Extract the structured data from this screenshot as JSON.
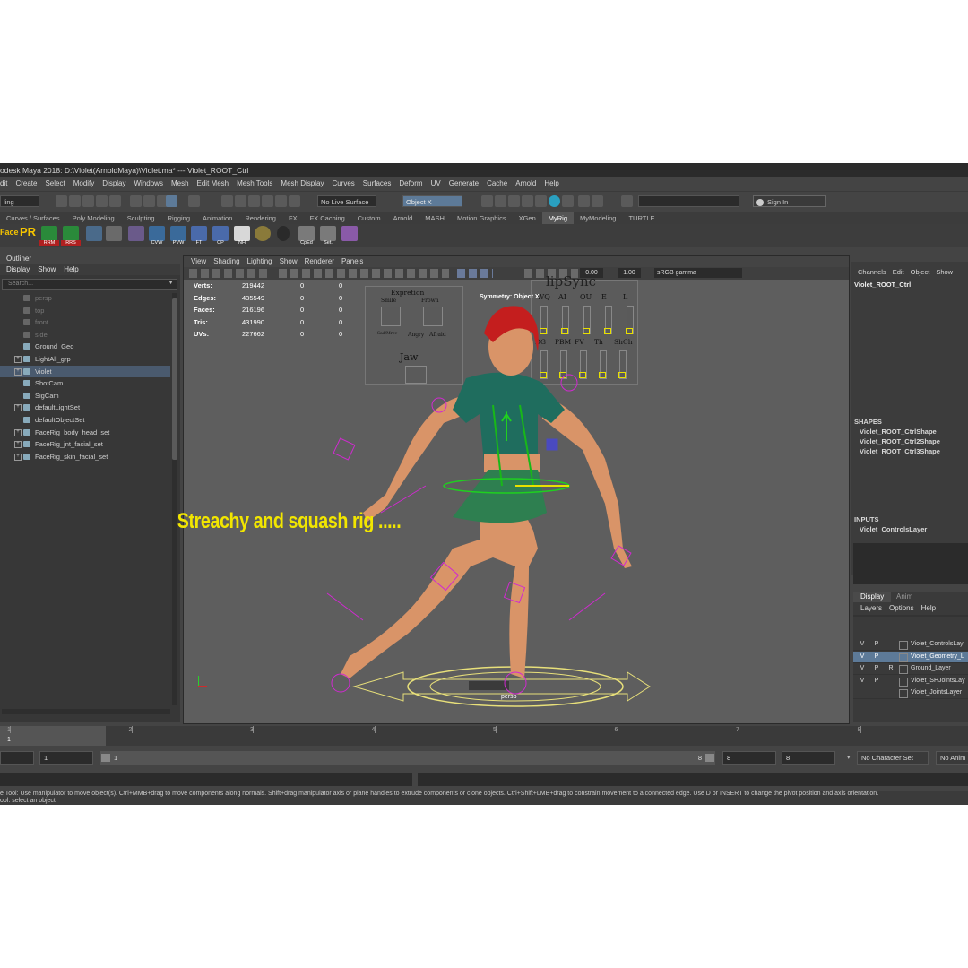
{
  "title_bar": {
    "text": "odesk Maya 2018: D:\\Violet(ArnoldMaya)\\Violet.ma*   ---   Violet_ROOT_Ctrl"
  },
  "menu": [
    "dit",
    "Create",
    "Select",
    "Modify",
    "Display",
    "Windows",
    "Mesh",
    "Edit Mesh",
    "Mesh Tools",
    "Mesh Display",
    "Curves",
    "Surfaces",
    "Deform",
    "UV",
    "Generate",
    "Cache",
    "Arnold",
    "Help"
  ],
  "status_line": {
    "mode_dropdown": "ling",
    "live_surface": "No Live Surface",
    "object_field": "Object X",
    "sign_in": "Sign In"
  },
  "shelf_tabs": [
    {
      "label": "Curves / Surfaces",
      "active": false
    },
    {
      "label": "Poly Modeling",
      "active": false
    },
    {
      "label": "Sculpting",
      "active": false
    },
    {
      "label": "Rigging",
      "active": false
    },
    {
      "label": "Animation",
      "active": false
    },
    {
      "label": "Rendering",
      "active": false
    },
    {
      "label": "FX",
      "active": false
    },
    {
      "label": "FX Caching",
      "active": false
    },
    {
      "label": "Custom",
      "active": false
    },
    {
      "label": "Arnold",
      "active": false
    },
    {
      "label": "MASH",
      "active": false
    },
    {
      "label": "Motion Graphics",
      "active": false
    },
    {
      "label": "XGen",
      "active": false
    },
    {
      "label": "MyRig",
      "active": true
    },
    {
      "label": "MyModeling",
      "active": false
    },
    {
      "label": "TURTLE",
      "active": false
    }
  ],
  "shelf": {
    "face_label": "Face",
    "pr_label": "PR",
    "icons": [
      "RRM",
      "RRS",
      "CVW",
      "PVW",
      "FT",
      "CP",
      "NH",
      "CpEd",
      "Set."
    ]
  },
  "outliner": {
    "title": "Outliner",
    "menu": [
      "Display",
      "Show",
      "Help"
    ],
    "search_placeholder": "Search...",
    "items": [
      {
        "label": "persp",
        "dim": true,
        "expand": false,
        "selected": false
      },
      {
        "label": "top",
        "dim": true,
        "expand": false,
        "selected": false
      },
      {
        "label": "front",
        "dim": true,
        "expand": false,
        "selected": false
      },
      {
        "label": "side",
        "dim": true,
        "expand": false,
        "selected": false
      },
      {
        "label": "Ground_Geo",
        "dim": false,
        "expand": false,
        "selected": false
      },
      {
        "label": "LightAll_grp",
        "dim": false,
        "expand": true,
        "selected": false
      },
      {
        "label": "Violet",
        "dim": false,
        "expand": true,
        "selected": true
      },
      {
        "label": "ShotCam",
        "dim": false,
        "expand": false,
        "selected": false
      },
      {
        "label": "SigCam",
        "dim": false,
        "expand": false,
        "selected": false
      },
      {
        "label": "defaultLightSet",
        "dim": false,
        "expand": true,
        "selected": false
      },
      {
        "label": "defaultObjectSet",
        "dim": false,
        "expand": false,
        "selected": false
      },
      {
        "label": "FaceRig_body_head_set",
        "dim": false,
        "expand": true,
        "selected": false
      },
      {
        "label": "FaceRig_jnt_facial_set",
        "dim": false,
        "expand": true,
        "selected": false
      },
      {
        "label": "FaceRig_skin_facial_set",
        "dim": false,
        "expand": true,
        "selected": false
      }
    ]
  },
  "viewport": {
    "menu": [
      "View",
      "Shading",
      "Lighting",
      "Show",
      "Renderer",
      "Panels"
    ],
    "exposure": "0.00",
    "gamma": "1.00",
    "color_space": "sRGB gamma",
    "camera_label": "persp",
    "symmetry": "Symmetry: Object X",
    "overlay_text": "Streachy and squash rig .....",
    "overlay_color": "#f2e600",
    "stats": [
      {
        "label": "Verts:",
        "value": "219442",
        "a": "0",
        "b": "0"
      },
      {
        "label": "Edges:",
        "value": "435549",
        "a": "0",
        "b": "0"
      },
      {
        "label": "Faces:",
        "value": "216196",
        "a": "0",
        "b": "0"
      },
      {
        "label": "Tris:",
        "value": "431990",
        "a": "0",
        "b": "0"
      },
      {
        "label": "UVs:",
        "value": "227662",
        "a": "0",
        "b": "0"
      }
    ],
    "face_ui": {
      "expression_title": "Expretion",
      "expressions": [
        "Smile",
        "Frown",
        "Sad/Mrev",
        "Angry",
        "Afraid"
      ],
      "jaw_label": "Jaw",
      "lipsync_title": "lipSync",
      "phonemes_top": [
        "WQ",
        "AI",
        "OU",
        "E",
        "L"
      ],
      "phonemes_bottom": [
        "DG",
        "PBM",
        "FV",
        "Th",
        "ShCh"
      ]
    }
  },
  "channel_box": {
    "menu": [
      "Channels",
      "Edit",
      "Object",
      "Show"
    ],
    "object_name": "Violet_ROOT_Ctrl",
    "shapes_heading": "SHAPES",
    "shapes": [
      "Violet_ROOT_CtrlShape",
      "Violet_ROOT_Ctrl2Shape",
      "Violet_ROOT_Ctrl3Shape"
    ],
    "inputs_heading": "INPUTS",
    "inputs": [
      "Violet_ControlsLayer"
    ]
  },
  "layer_editor": {
    "tabs": [
      "Display",
      "Anim"
    ],
    "menu": [
      "Layers",
      "Options",
      "Help"
    ],
    "layers": [
      {
        "v": "V",
        "p": "P",
        "r": "",
        "name": "Violet_ControlsLay",
        "selected": false
      },
      {
        "v": "V",
        "p": "P",
        "r": "",
        "name": "Violet_Geometry_L",
        "selected": true
      },
      {
        "v": "V",
        "p": "P",
        "r": "R",
        "name": "Ground_Layer",
        "selected": false
      },
      {
        "v": "V",
        "p": "P",
        "r": "",
        "name": "Violet_SHJointsLay",
        "selected": false
      },
      {
        "v": "",
        "p": "",
        "r": "",
        "name": "Violet_JointsLayer",
        "selected": false
      }
    ]
  },
  "timeline": {
    "ticks": [
      "1",
      "2",
      "3",
      "4",
      "5",
      "6",
      "7",
      "8"
    ],
    "current": "1"
  },
  "range": {
    "start": "1",
    "range_start": "1",
    "range_end": "8",
    "end1": "8",
    "end2": "8",
    "character_set": "No Character Set",
    "anim_layer": "No Anim"
  },
  "help_line": {
    "line1": "e Tool: Use manipulator to move object(s). Ctrl+MMB+drag to move components along normals. Shift+drag manipulator axis or plane handles to extrude components or clone objects. Ctrl+Shift+LMB+drag to constrain movement to a connected edge. Use D or INSERT to change the pivot position and axis orientation.",
    "line2": "ool. select an object"
  }
}
